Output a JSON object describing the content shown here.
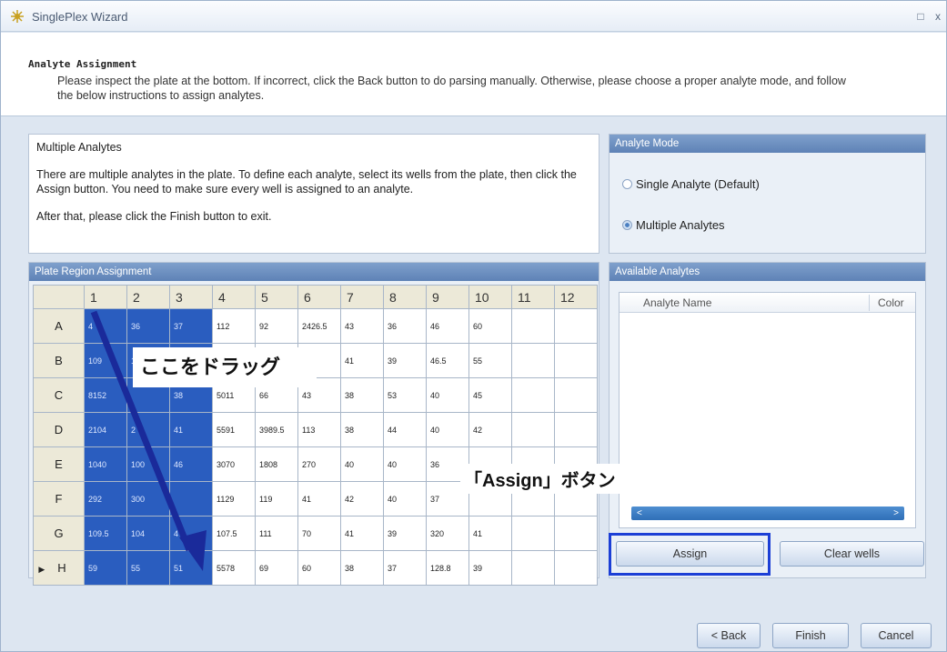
{
  "window": {
    "title": "SinglePlex Wizard",
    "restore_glyph": "□",
    "close_glyph": "x"
  },
  "header": {
    "title": "Analyte Assignment",
    "description": "Please inspect the plate at the bottom. If incorrect, click the Back button to do parsing manually. Otherwise, please choose a proper analyte mode, and follow the below instructions to assign analytes."
  },
  "info": {
    "title": "Multiple Analytes",
    "description": "There are multiple analytes in the plate. To define each analyte, select its wells from the plate, then click the Assign button. You need to make sure every well is assigned to an analyte.",
    "after": "After that, please click the Finish button to exit."
  },
  "analyte_mode": {
    "header": "Analyte Mode",
    "single_label": "Single Analyte (Default)",
    "multiple_label": "Multiple Analytes",
    "selected": "multiple"
  },
  "plate": {
    "header": "Plate Region Assignment",
    "columns": [
      "1",
      "2",
      "3",
      "4",
      "5",
      "6",
      "7",
      "8",
      "9",
      "10",
      "11",
      "12"
    ],
    "rows": [
      {
        "label": "A",
        "cells": [
          "4",
          "36",
          "37",
          "112",
          "92",
          "2426.5",
          "43",
          "36",
          "46",
          "60",
          "",
          ""
        ]
      },
      {
        "label": "B",
        "cells": [
          "109",
          "11",
          "",
          "",
          "",
          "",
          "41",
          "39",
          "46.5",
          "55",
          "",
          ""
        ]
      },
      {
        "label": "C",
        "cells": [
          "8152",
          "",
          "38",
          "5011",
          "66",
          "43",
          "38",
          "53",
          "40",
          "45",
          "",
          ""
        ]
      },
      {
        "label": "D",
        "cells": [
          "2104",
          "2",
          "41",
          "5591",
          "3989.5",
          "113",
          "38",
          "44",
          "40",
          "42",
          "",
          ""
        ]
      },
      {
        "label": "E",
        "cells": [
          "1040",
          "100",
          "46",
          "3070",
          "1808",
          "270",
          "40",
          "40",
          "36",
          "",
          "",
          ""
        ]
      },
      {
        "label": "F",
        "cells": [
          "292",
          "300",
          "",
          "1129",
          "119",
          "41",
          "42",
          "40",
          "37",
          "",
          "",
          ""
        ]
      },
      {
        "label": "G",
        "cells": [
          "109.5",
          "104",
          "4",
          "107.5",
          "111",
          "70",
          "41",
          "39",
          "320",
          "41",
          "",
          ""
        ]
      },
      {
        "label": "H",
        "cells": [
          "59",
          "55",
          "51",
          "5578",
          "69",
          "60",
          "38",
          "37",
          "128.8",
          "39",
          "",
          ""
        ]
      }
    ],
    "selected_columns": 3,
    "current_row_marker": "▶"
  },
  "available_analytes": {
    "header": "Available Analytes",
    "col_name": "Analyte Name",
    "col_color": "Color",
    "scroll_left": "<",
    "scroll_right": ">"
  },
  "buttons": {
    "assign": "Assign",
    "clear": "Clear wells",
    "back": "< Back",
    "finish": "Finish",
    "cancel": "Cancel"
  },
  "annotations": {
    "drag": "ここをドラッグ",
    "assign_button": "「Assign」ボタン",
    "arrow_color": "#1a2a9a",
    "highlight_color": "#1c3fd6"
  }
}
